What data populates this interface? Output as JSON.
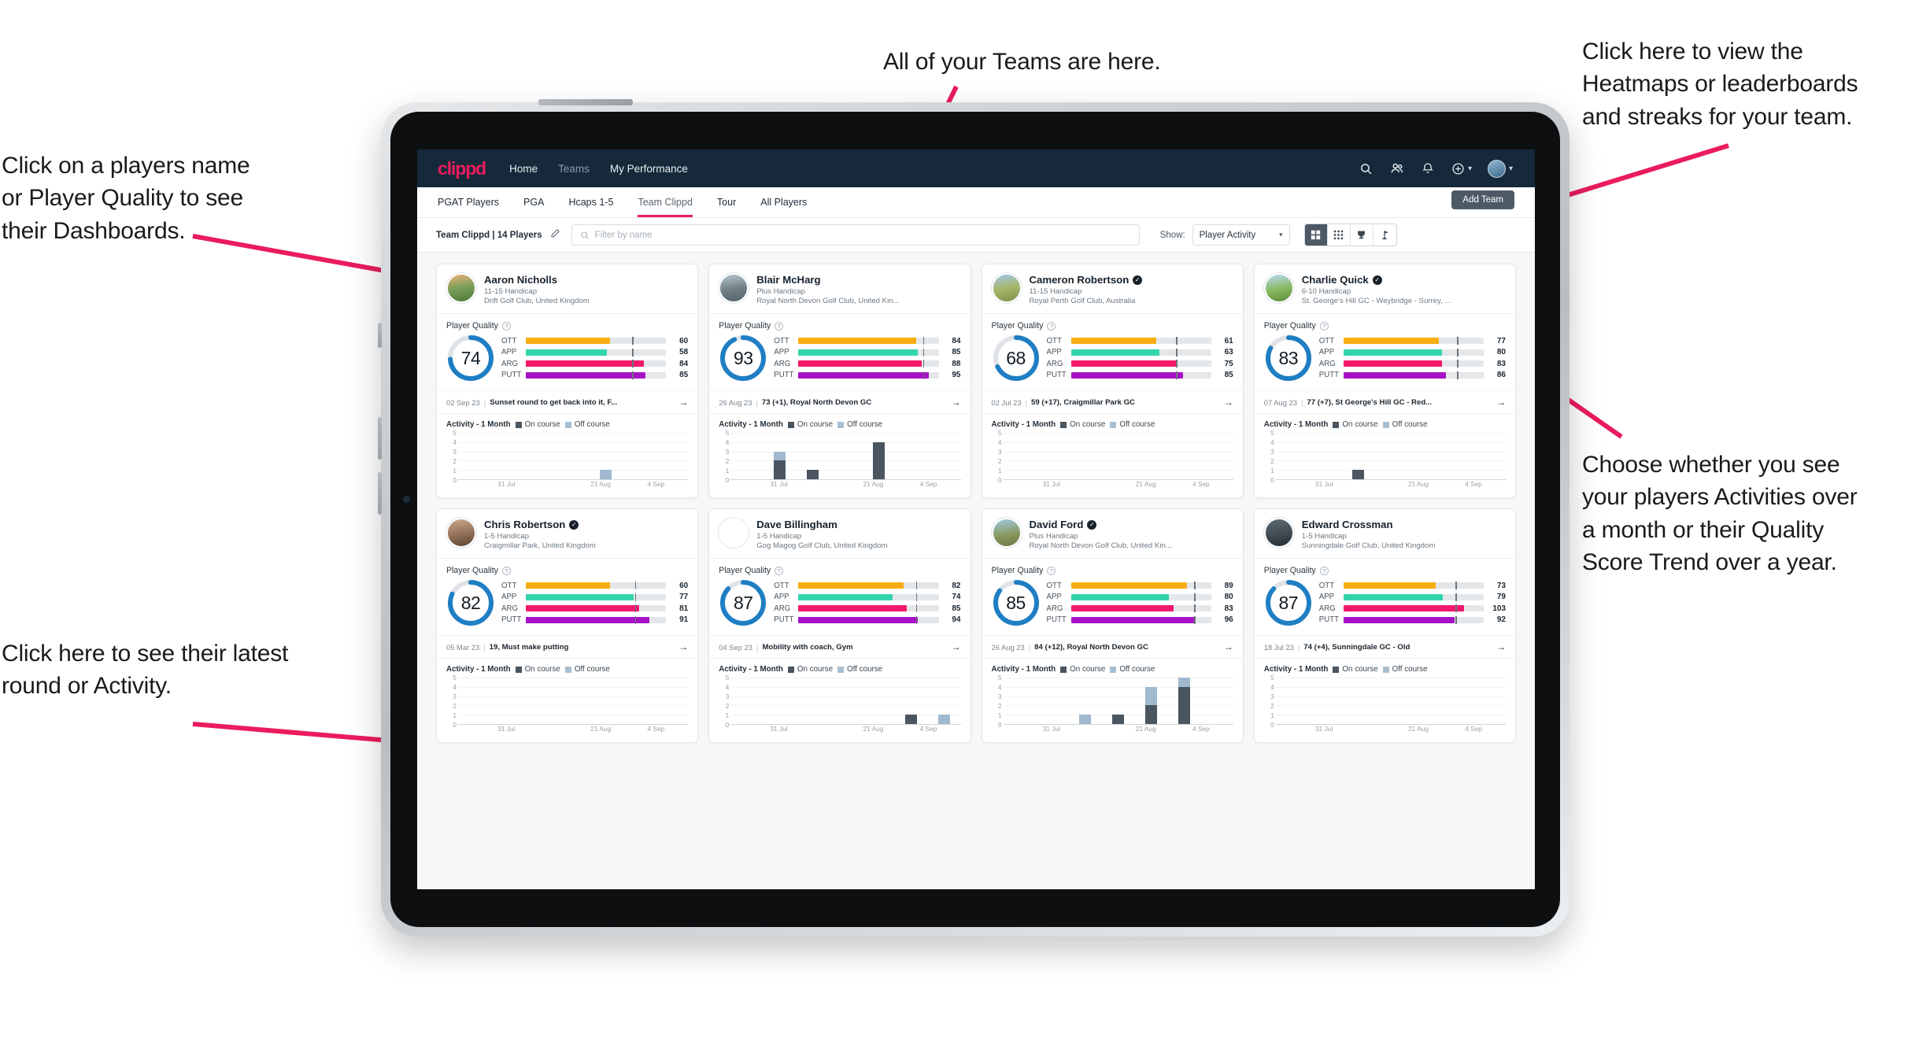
{
  "annotations": {
    "teams": "All of your Teams are here.",
    "heatmaps": "Click here to view the\nHeatmaps or leaderboards\nand streaks for your team.",
    "player_names": "Click on a players name\nor Player Quality to see\ntheir Dashboards.",
    "choose_view": "Choose whether you see\nyour players Activities over\na month or their Quality\nScore Trend over a year.",
    "latest_round": "Click here to see their latest\nround or Activity."
  },
  "topnav": {
    "logo": "clippd",
    "links": [
      {
        "label": "Home",
        "active": true
      },
      {
        "label": "Teams",
        "active": false
      },
      {
        "label": "My Performance",
        "active": true
      }
    ],
    "icons": [
      "search-icon",
      "people-icon",
      "bell-icon",
      "plus-circle-icon",
      "avatar"
    ]
  },
  "tabs": [
    {
      "label": "PGAT Players",
      "active": false
    },
    {
      "label": "PGA",
      "active": false
    },
    {
      "label": "Hcaps 1-5",
      "active": false
    },
    {
      "label": "Team Clippd",
      "active": true
    },
    {
      "label": "Tour",
      "active": false
    },
    {
      "label": "All Players",
      "active": false
    }
  ],
  "add_team_label": "Add Team",
  "filterbar": {
    "team_label": "Team Clippd | 14 Players",
    "edit_icon": "pencil-icon",
    "search_placeholder": "Filter by name",
    "show_label": "Show:",
    "show_value": "Player Activity",
    "view_toggles": [
      {
        "icon": "grid-large-icon",
        "active": true
      },
      {
        "icon": "grid-small-icon",
        "active": false
      },
      {
        "icon": "trophy-icon",
        "active": false
      },
      {
        "icon": "flag-icon",
        "active": false
      }
    ]
  },
  "quality_section_label": "Player Quality",
  "activity_label": "Activity - 1 Month",
  "legend": {
    "on": "On course",
    "off": "Off course"
  },
  "colors": {
    "accent": "#ea1c5d",
    "navy": "#15293a",
    "ring": "#1f7ec4",
    "ott": "#f8ad12",
    "app": "#32d4ad",
    "arg": "#f4186b",
    "putt": "#a711c6",
    "on_course": "#4a5560",
    "off_course": "#a0b9cf"
  },
  "chart_data": {
    "type": "bar",
    "title": "Activity - 1 Month",
    "ylim": [
      0,
      5
    ],
    "yticks": [
      0,
      1,
      2,
      3,
      4,
      5
    ],
    "xlabel": "",
    "ylabel": "",
    "grid": true,
    "legend": [
      "On course",
      "Off course"
    ],
    "xticks": [
      "31 Jul",
      "21 Aug",
      "4 Sep"
    ],
    "charts": [
      {
        "player": "Aaron Nicholls",
        "on": [
          0,
          0,
          0,
          0,
          0,
          0,
          0
        ],
        "off": [
          0,
          0,
          0,
          0,
          1,
          0,
          0
        ]
      },
      {
        "player": "Blair McHarg",
        "on": [
          0,
          2,
          1,
          0,
          4,
          0,
          0
        ],
        "off": [
          0,
          1,
          0,
          0,
          0,
          0,
          0
        ]
      },
      {
        "player": "Cameron Robertson",
        "on": [
          0,
          0,
          0,
          0,
          0,
          0,
          0
        ],
        "off": [
          0,
          0,
          0,
          0,
          0,
          0,
          0
        ]
      },
      {
        "player": "Charlie Quick",
        "on": [
          0,
          0,
          1,
          0,
          0,
          0,
          0
        ],
        "off": [
          0,
          0,
          0,
          0,
          0,
          0,
          0
        ]
      },
      {
        "player": "Chris Robertson",
        "on": [
          0,
          0,
          0,
          0,
          0,
          0,
          0
        ],
        "off": [
          0,
          0,
          0,
          0,
          0,
          0,
          0
        ]
      },
      {
        "player": "Dave Billingham",
        "on": [
          0,
          0,
          0,
          0,
          0,
          1,
          0
        ],
        "off": [
          0,
          0,
          0,
          0,
          0,
          0,
          1
        ]
      },
      {
        "player": "David Ford",
        "on": [
          0,
          0,
          0,
          1,
          2,
          4,
          0
        ],
        "off": [
          0,
          0,
          1,
          0,
          2,
          1,
          0
        ]
      },
      {
        "player": "Edward Crossman",
        "on": [
          0,
          0,
          0,
          0,
          0,
          0,
          0
        ],
        "off": [
          0,
          0,
          0,
          0,
          0,
          0,
          0
        ]
      }
    ]
  },
  "players": [
    {
      "name": "Aaron Nicholls",
      "verified": false,
      "handicap": "11-15 Handicap",
      "club": "Drift Golf Club, United Kingdom",
      "quality": 74,
      "metrics": [
        {
          "label": "OTT",
          "value": 60,
          "fill": 60,
          "tick": 76
        },
        {
          "label": "APP",
          "value": 58,
          "fill": 58,
          "tick": 76
        },
        {
          "label": "ARG",
          "value": 84,
          "fill": 84,
          "tick": 76
        },
        {
          "label": "PUTT",
          "value": 85,
          "fill": 85,
          "tick": 76
        }
      ],
      "round_date": "02 Sep 23",
      "round_text": "Sunset round to get back into it, F..."
    },
    {
      "name": "Blair McHarg",
      "verified": false,
      "handicap": "Plus Handicap",
      "club": "Royal North Devon Golf Club, United Kin...",
      "quality": 93,
      "metrics": [
        {
          "label": "OTT",
          "value": 84,
          "fill": 84,
          "tick": 89
        },
        {
          "label": "APP",
          "value": 85,
          "fill": 85,
          "tick": 89
        },
        {
          "label": "ARG",
          "value": 88,
          "fill": 88,
          "tick": 89
        },
        {
          "label": "PUTT",
          "value": 95,
          "fill": 93,
          "tick": 89
        }
      ],
      "round_date": "26 Aug 23",
      "round_text": "73 (+1), Royal North Devon GC"
    },
    {
      "name": "Cameron Robertson",
      "verified": true,
      "handicap": "11-15 Handicap",
      "club": "Royal Perth Golf Club, Australia",
      "quality": 68,
      "metrics": [
        {
          "label": "OTT",
          "value": 61,
          "fill": 61,
          "tick": 75
        },
        {
          "label": "APP",
          "value": 63,
          "fill": 63,
          "tick": 75
        },
        {
          "label": "ARG",
          "value": 75,
          "fill": 75,
          "tick": 75
        },
        {
          "label": "PUTT",
          "value": 85,
          "fill": 80,
          "tick": 75
        }
      ],
      "round_date": "02 Jul 23",
      "round_text": "59 (+17), Craigmillar Park GC"
    },
    {
      "name": "Charlie Quick",
      "verified": true,
      "handicap": "6-10 Handicap",
      "club": "St. George's Hill GC - Weybridge - Surrey, ...",
      "quality": 83,
      "metrics": [
        {
          "label": "OTT",
          "value": 77,
          "fill": 68,
          "tick": 81
        },
        {
          "label": "APP",
          "value": 80,
          "fill": 70,
          "tick": 81
        },
        {
          "label": "ARG",
          "value": 83,
          "fill": 70,
          "tick": 81
        },
        {
          "label": "PUTT",
          "value": 86,
          "fill": 73,
          "tick": 81
        }
      ],
      "round_date": "07 Aug 23",
      "round_text": "77 (+7), St George's Hill GC - Red..."
    },
    {
      "name": "Chris Robertson",
      "verified": true,
      "handicap": "1-5 Handicap",
      "club": "Craigmillar Park, United Kingdom",
      "quality": 82,
      "metrics": [
        {
          "label": "OTT",
          "value": 60,
          "fill": 60,
          "tick": 78
        },
        {
          "label": "APP",
          "value": 77,
          "fill": 77,
          "tick": 78
        },
        {
          "label": "ARG",
          "value": 81,
          "fill": 81,
          "tick": 78
        },
        {
          "label": "PUTT",
          "value": 91,
          "fill": 88,
          "tick": 78
        }
      ],
      "round_date": "05 Mar 23",
      "round_text": "19, Must make putting"
    },
    {
      "name": "Dave Billingham",
      "verified": false,
      "handicap": "1-5 Handicap",
      "club": "Gog Magog Golf Club, United Kingdom",
      "quality": 87,
      "metrics": [
        {
          "label": "OTT",
          "value": 82,
          "fill": 75,
          "tick": 84
        },
        {
          "label": "APP",
          "value": 74,
          "fill": 67,
          "tick": 84
        },
        {
          "label": "ARG",
          "value": 85,
          "fill": 77,
          "tick": 84
        },
        {
          "label": "PUTT",
          "value": 94,
          "fill": 85,
          "tick": 84
        }
      ],
      "round_date": "04 Sep 23",
      "round_text": "Mobility with coach, Gym"
    },
    {
      "name": "David Ford",
      "verified": true,
      "handicap": "Plus Handicap",
      "club": "Royal North Devon Golf Club, United Kin...",
      "quality": 85,
      "metrics": [
        {
          "label": "OTT",
          "value": 89,
          "fill": 83,
          "tick": 88
        },
        {
          "label": "APP",
          "value": 80,
          "fill": 70,
          "tick": 88
        },
        {
          "label": "ARG",
          "value": 83,
          "fill": 73,
          "tick": 88
        },
        {
          "label": "PUTT",
          "value": 96,
          "fill": 88,
          "tick": 88
        }
      ],
      "round_date": "26 Aug 23",
      "round_text": "84 (+12), Royal North Devon GC"
    },
    {
      "name": "Edward Crossman",
      "verified": false,
      "handicap": "1-5 Handicap",
      "club": "Sunningdale Golf Club, United Kingdom",
      "quality": 87,
      "metrics": [
        {
          "label": "OTT",
          "value": 73,
          "fill": 66,
          "tick": 80
        },
        {
          "label": "APP",
          "value": 79,
          "fill": 71,
          "tick": 80
        },
        {
          "label": "ARG",
          "value": 103,
          "fill": 86,
          "tick": 80
        },
        {
          "label": "PUTT",
          "value": 92,
          "fill": 79,
          "tick": 80
        }
      ],
      "round_date": "18 Jul 23",
      "round_text": "74 (+4), Sunningdale GC - Old"
    }
  ]
}
